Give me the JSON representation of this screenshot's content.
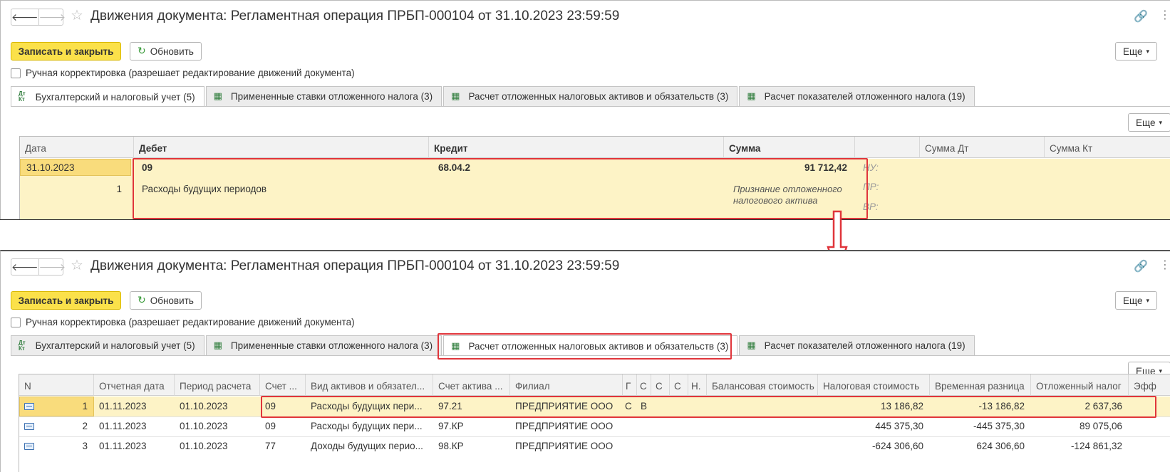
{
  "window": {
    "title": "Движения документа: Регламентная операция ПРБП-000104 от 31.10.2023 23:59:59"
  },
  "toolbar": {
    "save_close_label": "Записать и закрыть",
    "refresh_label": "Обновить",
    "more_label": "Еще",
    "manual_edit_label": "Ручная корректировка (разрешает редактирование движений документа)"
  },
  "tabs": [
    {
      "label": "Бухгалтерский и налоговый учет (5)",
      "icon": "dt-kt-icon"
    },
    {
      "label": "Примененные ставки отложенного налога (3)",
      "icon": "table-icon"
    },
    {
      "label": "Расчет отложенных налоговых активов и обязательств (3)",
      "icon": "table-icon"
    },
    {
      "label": "Расчет показателей отложенного налога (19)",
      "icon": "table-icon"
    }
  ],
  "top_grid": {
    "more_label": "Еще",
    "headers": {
      "date": "Дата",
      "debit": "Дебет",
      "credit": "Кредит",
      "sum": "Сумма",
      "sum_dt": "Сумма Дт",
      "sum_kt": "Сумма Кт"
    },
    "row": {
      "date": "31.10.2023",
      "line_no": "1",
      "debit_account": "09",
      "debit_subconto": "Расходы будущих периодов",
      "credit_account": "68.04.2",
      "sum": "91 712,42",
      "content_line1": "Признание отложенного",
      "content_line2": "налогового актива",
      "nu_label": "НУ:",
      "pr_label": "ПР:",
      "vr_label": "ВР:"
    }
  },
  "bottom_grid": {
    "more_label": "Еще",
    "headers": {
      "n": "N",
      "report_date": "Отчетная дата",
      "period": "Период расчета",
      "account": "Счет ...",
      "asset_type": "Вид активов и обязател...",
      "asset_account": "Счет актива ...",
      "branch": "Филиал",
      "c1": "Г",
      "c2": "С",
      "c3": "С",
      "c4": "С",
      "c5": "Н.",
      "balance": "Балансовая стоимость",
      "tax_value": "Налоговая стоимость",
      "temp_diff": "Временная разница",
      "deferred": "Отложенный налог",
      "eff": "Эфф"
    },
    "rows": [
      {
        "n": "1",
        "report_date": "01.11.2023",
        "period": "01.10.2023",
        "account": "09",
        "asset_type": "Расходы будущих пери...",
        "asset_account": "97.21",
        "branch": "ПРЕДПРИЯТИЕ ООО",
        "c1": "С",
        "c2": "В",
        "tax_value": "13 186,82",
        "temp_diff": "-13 186,82",
        "deferred": "2 637,36"
      },
      {
        "n": "2",
        "report_date": "01.11.2023",
        "period": "01.10.2023",
        "account": "09",
        "asset_type": "Расходы будущих пери...",
        "asset_account": "97.КР",
        "branch": "ПРЕДПРИЯТИЕ ООО",
        "c1": "",
        "c2": "",
        "tax_value": "445 375,30",
        "temp_diff": "-445 375,30",
        "deferred": "89 075,06"
      },
      {
        "n": "3",
        "report_date": "01.11.2023",
        "period": "01.10.2023",
        "account": "77",
        "asset_type": "Доходы будущих перио...",
        "asset_account": "98.КР",
        "branch": "ПРЕДПРИЯТИЕ ООО",
        "c1": "",
        "c2": "",
        "tax_value": "-624 306,60",
        "temp_diff": "624 306,60",
        "deferred": "-124 861,32"
      }
    ]
  },
  "colors": {
    "primary_button": "#fbe14a",
    "highlight_border": "#e0353b",
    "selected_row": "#fdf3c6"
  }
}
